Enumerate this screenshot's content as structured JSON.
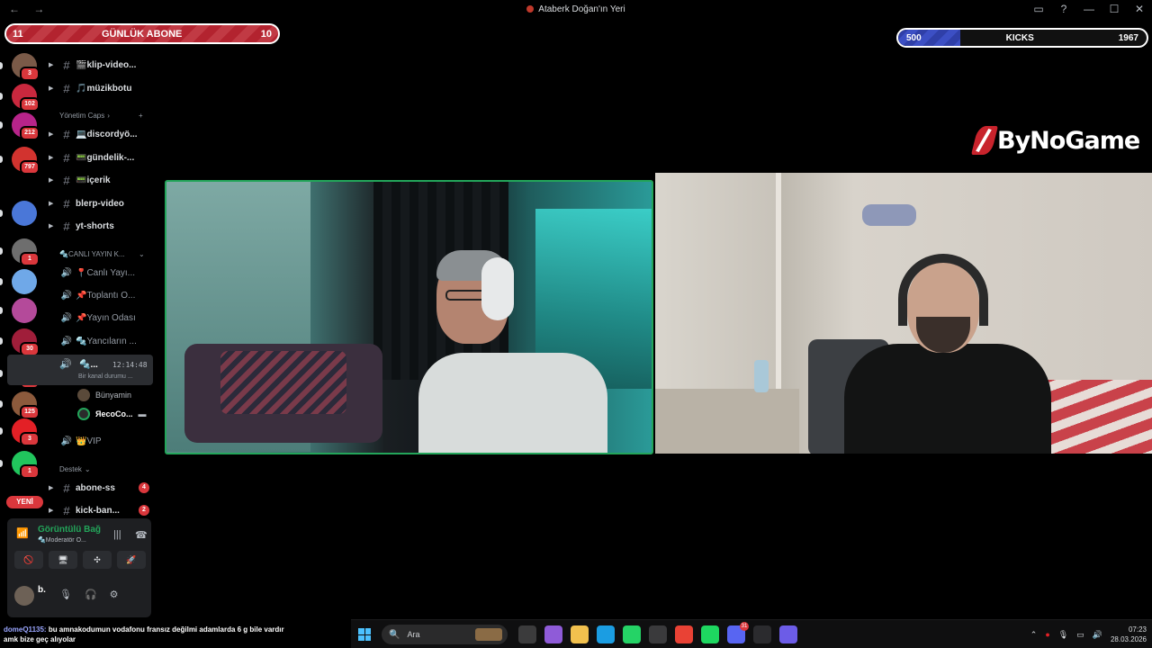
{
  "window": {
    "title": "Ataberk Doğan'ın Yeri",
    "nav": "← →",
    "controls": [
      "▭",
      "?",
      "—",
      "☐",
      "✕"
    ]
  },
  "overlays": {
    "sub_goal": {
      "left": "11",
      "label": "GÜNLÜK ABONE",
      "right": "10"
    },
    "kicks": {
      "left": "500",
      "label": "KICKS",
      "right": "1967",
      "fill": 0.25
    },
    "brand": "ByNoGame"
  },
  "servers": [
    {
      "badge": "3",
      "color": "#7a5a48"
    },
    {
      "badge": "102",
      "color": "#c9283e"
    },
    {
      "badge": "212",
      "color": "#b7248a"
    },
    {
      "badge": "797",
      "color": "#d2332f"
    },
    {
      "badge": "",
      "color": "#4a77d8"
    },
    {
      "badge": "1",
      "color": "#6e6e6e"
    },
    {
      "badge": "",
      "color": "#6fa8e8"
    },
    {
      "badge": "",
      "color": "#b44a9a"
    },
    {
      "badge": "30",
      "color": "#a01e3a"
    },
    {
      "badge": "7",
      "color": "#2b2b2b"
    },
    {
      "badge": "125",
      "color": "#8c5a3c"
    },
    {
      "badge": "3",
      "color": "#e32026"
    },
    {
      "badge": "1",
      "color": "#21c55d"
    }
  ],
  "new_label": "YENİ",
  "channels": [
    {
      "name": "🎬klip-video...",
      "type": "text"
    },
    {
      "name": "🎵müzikbotu",
      "type": "text"
    }
  ],
  "cat_manage": "Yönetim Caps",
  "channels_manage": [
    {
      "name": "💻discordyö...",
      "type": "text"
    },
    {
      "name": "📟gündelik-...",
      "type": "text"
    },
    {
      "name": "📟içerik",
      "type": "text"
    },
    {
      "name": "blerp-video",
      "type": "text"
    },
    {
      "name": "yt-shorts",
      "type": "text"
    }
  ],
  "cat_live": "🔩CANLI YAYIN K...",
  "voice_channels": [
    {
      "name": "📍Canlı Yayı..."
    },
    {
      "name": "📌Toplantı O..."
    },
    {
      "name": "📌Yayın Odası"
    },
    {
      "name": "🔩Yancıların ..."
    }
  ],
  "active_channel": {
    "name": "🔩...",
    "time": "12:14:48",
    "status": "Bir kanal durumu ..."
  },
  "voice_users": [
    "Bünyamin",
    "ЯecoCo..."
  ],
  "vip_channel": "👑VIP",
  "cat_support": "Destek",
  "support_channels": [
    {
      "name": "abone-ss",
      "count": "4"
    },
    {
      "name": "kick-ban...",
      "count": "2"
    }
  ],
  "voice_panel": {
    "status": "Görüntülü Bağ",
    "sub": "🔩Moderatör O...",
    "buttons": [
      "🚫",
      "🖥",
      "✣",
      "🚀"
    ]
  },
  "user": {
    "name": "b."
  },
  "chat": {
    "nick": "domeQ1135:",
    "text": "bu amnakodumun vodafonu fransız değilmi adamlarda 6 g bile vardır amk bize geç alıyolar"
  },
  "taskbar": {
    "search_placeholder": "Ara",
    "time": "07:23",
    "date": "28.03.2026",
    "apps": [
      {
        "name": "taskview",
        "color": "#3b3b3c"
      },
      {
        "name": "copilot",
        "color": "#8f5bd8"
      },
      {
        "name": "explorer",
        "color": "#f2c14e"
      },
      {
        "name": "edge",
        "color": "#1b9de2"
      },
      {
        "name": "whatsapp",
        "color": "#25d366"
      },
      {
        "name": "store",
        "color": "#3a3a3c"
      },
      {
        "name": "chrome",
        "color": "#e94235"
      },
      {
        "name": "spotify",
        "color": "#1ed760"
      },
      {
        "name": "discord",
        "color": "#5865f2"
      },
      {
        "name": "obs",
        "color": "#2b2b2e"
      },
      {
        "name": "app-circle",
        "color": "#6c5ce7"
      }
    ],
    "discord_badge": "31"
  }
}
